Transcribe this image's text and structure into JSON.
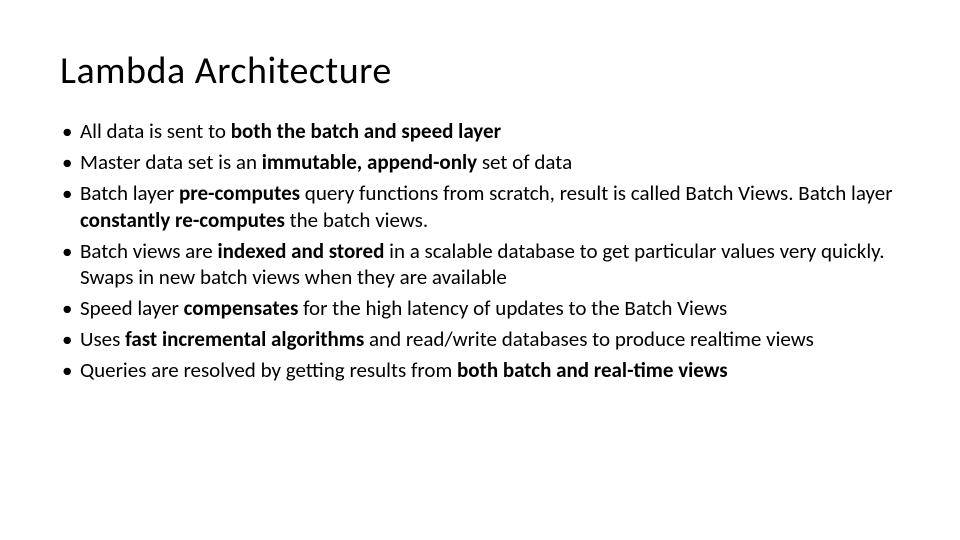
{
  "title": "Lambda Architecture",
  "bullets": [
    {
      "segments": [
        {
          "t": "All data is sent to ",
          "b": false
        },
        {
          "t": "both the batch and speed layer",
          "b": true
        }
      ]
    },
    {
      "segments": [
        {
          "t": "Master data set is an ",
          "b": false
        },
        {
          "t": "immutable, append-only",
          "b": true
        },
        {
          "t": " set of data",
          "b": false
        }
      ]
    },
    {
      "segments": [
        {
          "t": "Batch layer ",
          "b": false
        },
        {
          "t": "pre-computes",
          "b": true
        },
        {
          "t": " query functions from scratch, result is called Batch Views. Batch layer ",
          "b": false
        },
        {
          "t": "constantly re-computes",
          "b": true
        },
        {
          "t": " the batch views.",
          "b": false
        }
      ]
    },
    {
      "segments": [
        {
          "t": "Batch views are ",
          "b": false
        },
        {
          "t": "indexed and stored",
          "b": true
        },
        {
          "t": " in a scalable database to get particular values very quickly. Swaps in new batch views when they are available",
          "b": false
        }
      ]
    },
    {
      "segments": [
        {
          "t": "Speed layer ",
          "b": false
        },
        {
          "t": "compensates",
          "b": true
        },
        {
          "t": " for the high latency of updates to the Batch Views",
          "b": false
        }
      ]
    },
    {
      "segments": [
        {
          "t": "Uses ",
          "b": false
        },
        {
          "t": "fast incremental algorithms",
          "b": true
        },
        {
          "t": " and read/write databases to produce realtime views",
          "b": false
        }
      ]
    },
    {
      "segments": [
        {
          "t": "Queries are resolved by getting results from ",
          "b": false
        },
        {
          "t": "both batch and real-time views",
          "b": true
        }
      ]
    }
  ]
}
